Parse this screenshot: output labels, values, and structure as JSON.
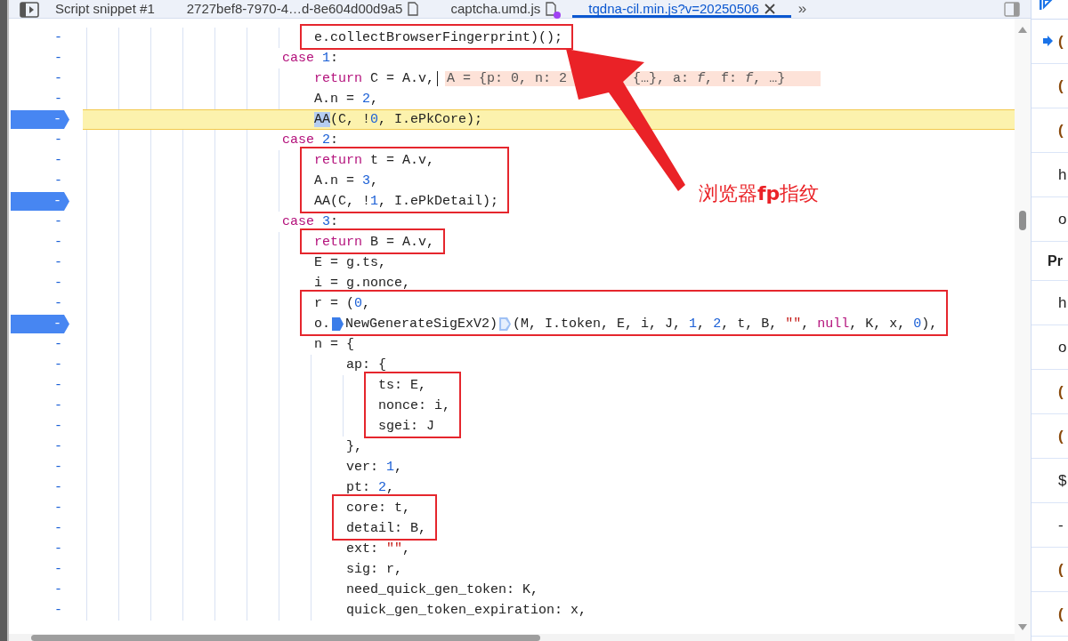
{
  "tabs": [
    {
      "label": "Script snippet #1",
      "kind": "snippet",
      "selected": false,
      "modified": false
    },
    {
      "label": "2727bef8-7970-4…d-8e604d00d9a5",
      "kind": "source",
      "selected": false,
      "modified": false
    },
    {
      "label": "captcha.umd.js",
      "kind": "source",
      "selected": false,
      "modified": true
    },
    {
      "label": "tqdna-cil.min.js?v=20250506",
      "kind": "source",
      "selected": true,
      "modified": false
    }
  ],
  "more_tabs": "»",
  "editor": {
    "lines": [
      {
        "children": [
          {
            "gutter": "-",
            "breakpoint": false,
            "current": false,
            "boxed": true,
            "tokens": [
              {
                "kind": "plain",
                "text": "e.collectBrowserFingerprint)();"
              }
            ]
          }
        ]
      },
      {
        "gutter": "-",
        "breakpoint": false,
        "current": false,
        "tokens": [
          {
            "kind": "keyword",
            "text": "case"
          },
          {
            "kind": "number",
            "text": " 1"
          },
          {
            "kind": "plain",
            "text": ":"
          }
        ],
        "children": [
          {
            "gutter": "-",
            "breakpoint": false,
            "current": false,
            "cursor": true,
            "inline_value": [
              "A = {p: 0, n: 2",
              "{…}, a: *f*, f: *f*, …}"
            ],
            "tokens": [
              {
                "kind": "keyword",
                "text": "return"
              },
              {
                "kind": "plain",
                "text": " C = A.v,"
              }
            ]
          },
          {
            "gutter": "-",
            "breakpoint": false,
            "current": false,
            "tokens": [
              {
                "kind": "plain",
                "text": "A.n = "
              },
              {
                "kind": "number",
                "text": "2"
              },
              {
                "kind": "plain",
                "text": ","
              }
            ]
          },
          {
            "gutter": "-",
            "breakpoint": true,
            "current": true,
            "tokens": [
              {
                "kind": "plain",
                "text": "AA",
                "highlighted": true
              },
              {
                "kind": "plain",
                "text": "(C, !"
              },
              {
                "kind": "number",
                "text": "0"
              },
              {
                "kind": "plain",
                "text": ", I.ePkCore);"
              }
            ]
          }
        ]
      },
      {
        "gutter": "-",
        "breakpoint": false,
        "current": false,
        "tokens": [
          {
            "kind": "keyword",
            "text": "case"
          },
          {
            "kind": "number",
            "text": " 2"
          },
          {
            "kind": "plain",
            "text": ":"
          }
        ],
        "children": [
          {
            "gutter": "-",
            "breakpoint": false,
            "current": false,
            "boxed": true,
            "tokens": [
              {
                "kind": "keyword",
                "text": "return"
              },
              {
                "kind": "plain",
                "text": " t = A.v,"
              }
            ]
          },
          {
            "gutter": "-",
            "breakpoint": false,
            "current": false,
            "boxed": true,
            "tokens": [
              {
                "kind": "plain",
                "text": "A.n = "
              },
              {
                "kind": "number",
                "text": "3"
              },
              {
                "kind": "plain",
                "text": ","
              }
            ]
          },
          {
            "gutter": "-",
            "breakpoint": true,
            "current": false,
            "boxed": true,
            "tokens": [
              {
                "kind": "plain",
                "text": "AA(C, !"
              },
              {
                "kind": "number",
                "text": "1"
              },
              {
                "kind": "plain",
                "text": ", I.ePkDetail);"
              }
            ]
          }
        ]
      },
      {
        "gutter": "-",
        "breakpoint": false,
        "current": false,
        "tokens": [
          {
            "kind": "keyword",
            "text": "case"
          },
          {
            "kind": "number",
            "text": " 3"
          },
          {
            "kind": "plain",
            "text": ":"
          }
        ],
        "children": [
          {
            "gutter": "-",
            "breakpoint": false,
            "current": false,
            "boxed": true,
            "tokens": [
              {
                "kind": "keyword",
                "text": "return"
              },
              {
                "kind": "plain",
                "text": " B = A.v,"
              }
            ]
          },
          {
            "gutter": "-",
            "breakpoint": false,
            "current": false,
            "tokens": [
              {
                "kind": "plain",
                "text": "E = g.ts,"
              }
            ]
          },
          {
            "gutter": "-",
            "breakpoint": false,
            "current": false,
            "tokens": [
              {
                "kind": "plain",
                "text": "i = g.nonce,"
              }
            ]
          },
          {
            "gutter": "-",
            "breakpoint": false,
            "current": false,
            "boxed": true,
            "tokens": [
              {
                "kind": "plain",
                "text": "r = ("
              },
              {
                "kind": "number",
                "text": "0"
              },
              {
                "kind": "plain",
                "text": ","
              }
            ]
          },
          {
            "gutter": "-",
            "breakpoint": true,
            "current": false,
            "boxed": true,
            "tokens": [
              {
                "kind": "plain",
                "text": "o."
              },
              {
                "kind": "marker",
                "active": true
              },
              {
                "kind": "plain",
                "text": "NewGenerateSigExV2)"
              },
              {
                "kind": "marker",
                "active": false
              },
              {
                "kind": "plain",
                "text": "(M, I.token, E, i, J, "
              },
              {
                "kind": "number",
                "text": "1"
              },
              {
                "kind": "plain",
                "text": ", "
              },
              {
                "kind": "number",
                "text": "2"
              },
              {
                "kind": "plain",
                "text": ", t, B, "
              },
              {
                "kind": "string",
                "text": "\"\""
              },
              {
                "kind": "plain",
                "text": ", "
              },
              {
                "kind": "keyword",
                "text": "null"
              },
              {
                "kind": "plain",
                "text": ", K, x, "
              },
              {
                "kind": "number",
                "text": "0"
              },
              {
                "kind": "plain",
                "text": "),"
              }
            ]
          },
          {
            "gutter": "-",
            "breakpoint": false,
            "current": false,
            "tokens": [
              {
                "kind": "plain",
                "text": "n = {"
              }
            ],
            "children": [
              {
                "gutter": "-",
                "breakpoint": false,
                "current": false,
                "tokens": [
                  {
                    "kind": "plain",
                    "text": "ap: {"
                  }
                ],
                "children": [
                  {
                    "gutter": "-",
                    "breakpoint": false,
                    "current": false,
                    "boxed": true,
                    "tokens": [
                      {
                        "kind": "plain",
                        "text": "ts: E,"
                      }
                    ]
                  },
                  {
                    "gutter": "-",
                    "breakpoint": false,
                    "current": false,
                    "boxed": true,
                    "tokens": [
                      {
                        "kind": "plain",
                        "text": "nonce: i,"
                      }
                    ]
                  },
                  {
                    "gutter": "-",
                    "breakpoint": false,
                    "current": false,
                    "boxed": true,
                    "tokens": [
                      {
                        "kind": "plain",
                        "text": "sgei: J"
                      }
                    ]
                  }
                ]
              },
              {
                "gutter": "-",
                "breakpoint": false,
                "current": false,
                "tokens": [
                  {
                    "kind": "plain",
                    "text": "},"
                  }
                ]
              },
              {
                "gutter": "-",
                "breakpoint": false,
                "current": false,
                "tokens": [
                  {
                    "kind": "plain",
                    "text": "ver: "
                  },
                  {
                    "kind": "number",
                    "text": "1"
                  },
                  {
                    "kind": "plain",
                    "text": ","
                  }
                ]
              },
              {
                "gutter": "-",
                "breakpoint": false,
                "current": false,
                "tokens": [
                  {
                    "kind": "plain",
                    "text": "pt: "
                  },
                  {
                    "kind": "number",
                    "text": "2"
                  },
                  {
                    "kind": "plain",
                    "text": ","
                  }
                ]
              },
              {
                "gutter": "-",
                "breakpoint": false,
                "current": false,
                "boxed": true,
                "tokens": [
                  {
                    "kind": "plain",
                    "text": "core: t,"
                  }
                ]
              },
              {
                "gutter": "-",
                "breakpoint": false,
                "current": false,
                "boxed": true,
                "tokens": [
                  {
                    "kind": "plain",
                    "text": "detail: B,"
                  }
                ]
              },
              {
                "gutter": "-",
                "breakpoint": false,
                "current": false,
                "tokens": [
                  {
                    "kind": "plain",
                    "text": "ext: "
                  },
                  {
                    "kind": "string",
                    "text": "\"\""
                  },
                  {
                    "kind": "plain",
                    "text": ","
                  }
                ]
              },
              {
                "gutter": "-",
                "breakpoint": false,
                "current": false,
                "tokens": [
                  {
                    "kind": "plain",
                    "text": "sig: r,"
                  }
                ]
              },
              {
                "gutter": "-",
                "breakpoint": false,
                "current": false,
                "tokens": [
                  {
                    "kind": "plain",
                    "text": "need_quick_gen_token: K,"
                  }
                ]
              },
              {
                "gutter": "-",
                "breakpoint": false,
                "current": false,
                "tokens": [
                  {
                    "kind": "plain",
                    "text": "quick_gen_token_expiration: x,"
                  }
                ]
              }
            ]
          }
        ]
      }
    ]
  },
  "annotation": {
    "label": "浏览器**fp**指纹"
  },
  "call_stack": [
    {
      "kind": "frame",
      "text": "(",
      "current": true
    },
    {
      "kind": "frame",
      "text": "(",
      "current": false
    },
    {
      "kind": "frame",
      "text": "(",
      "current": false
    },
    {
      "kind": "text",
      "text": "h",
      "current": false
    },
    {
      "kind": "text",
      "text": "o",
      "current": false
    },
    {
      "kind": "header",
      "text": "Pr",
      "current": false
    },
    {
      "kind": "text",
      "text": "h",
      "current": false
    },
    {
      "kind": "text",
      "text": "o",
      "current": false
    },
    {
      "kind": "frame",
      "text": "(",
      "current": false
    },
    {
      "kind": "frame",
      "text": "(",
      "current": false
    },
    {
      "kind": "text",
      "text": "$",
      "current": false
    },
    {
      "kind": "text",
      "text": "-",
      "current": false
    },
    {
      "kind": "frame",
      "text": "(",
      "current": false
    },
    {
      "kind": "frame",
      "text": "(",
      "current": false
    }
  ]
}
